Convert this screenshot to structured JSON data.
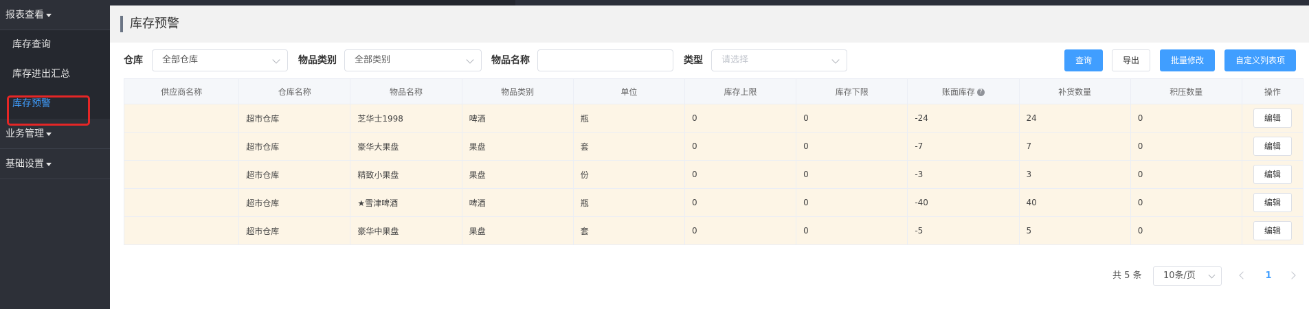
{
  "sidebar": {
    "groups": [
      {
        "label": "报表查看",
        "items": [
          "库存查询",
          "库存进出汇总",
          "库存预警"
        ],
        "active": "库存预警"
      },
      {
        "label": "业务管理"
      },
      {
        "label": "基础设置"
      }
    ]
  },
  "page": {
    "title": "库存预警"
  },
  "filters": {
    "warehouse": {
      "label": "仓库",
      "value": "全部仓库"
    },
    "category": {
      "label": "物品类别",
      "value": "全部类别"
    },
    "item_name": {
      "label": "物品名称",
      "value": ""
    },
    "type": {
      "label": "类型",
      "placeholder": "请选择"
    }
  },
  "buttons": {
    "query": "查询",
    "export": "导出",
    "batch_edit": "批量修改",
    "custom_columns": "自定义列表项"
  },
  "table": {
    "headers": [
      "供应商名称",
      "仓库名称",
      "物品名称",
      "物品类别",
      "单位",
      "库存上限",
      "库存下限",
      "账面库存",
      "补货数量",
      "积压数量",
      "操作"
    ],
    "rows": [
      [
        "",
        "超市仓库",
        "芝华士1998",
        "啤酒",
        "瓶",
        "0",
        "0",
        "-24",
        "24",
        "0"
      ],
      [
        "",
        "超市仓库",
        "豪华大果盘",
        "果盘",
        "套",
        "0",
        "0",
        "-7",
        "7",
        "0"
      ],
      [
        "",
        "超市仓库",
        "精致小果盘",
        "果盘",
        "份",
        "0",
        "0",
        "-3",
        "3",
        "0"
      ],
      [
        "",
        "超市仓库",
        "★雪津啤酒",
        "啤酒",
        "瓶",
        "0",
        "0",
        "-40",
        "40",
        "0"
      ],
      [
        "",
        "超市仓库",
        "豪华中果盘",
        "果盘",
        "套",
        "0",
        "0",
        "-5",
        "5",
        "0"
      ]
    ],
    "edit_label": "编辑",
    "help_glyph": "?"
  },
  "pagination": {
    "total": "共 5 条",
    "page_size": "10条/页",
    "current_page": "1"
  },
  "colors": {
    "primary": "#409eff",
    "sidebar_bg": "#2d3038",
    "row_bg": "#fdf5e6",
    "highlight": "#e52626"
  }
}
